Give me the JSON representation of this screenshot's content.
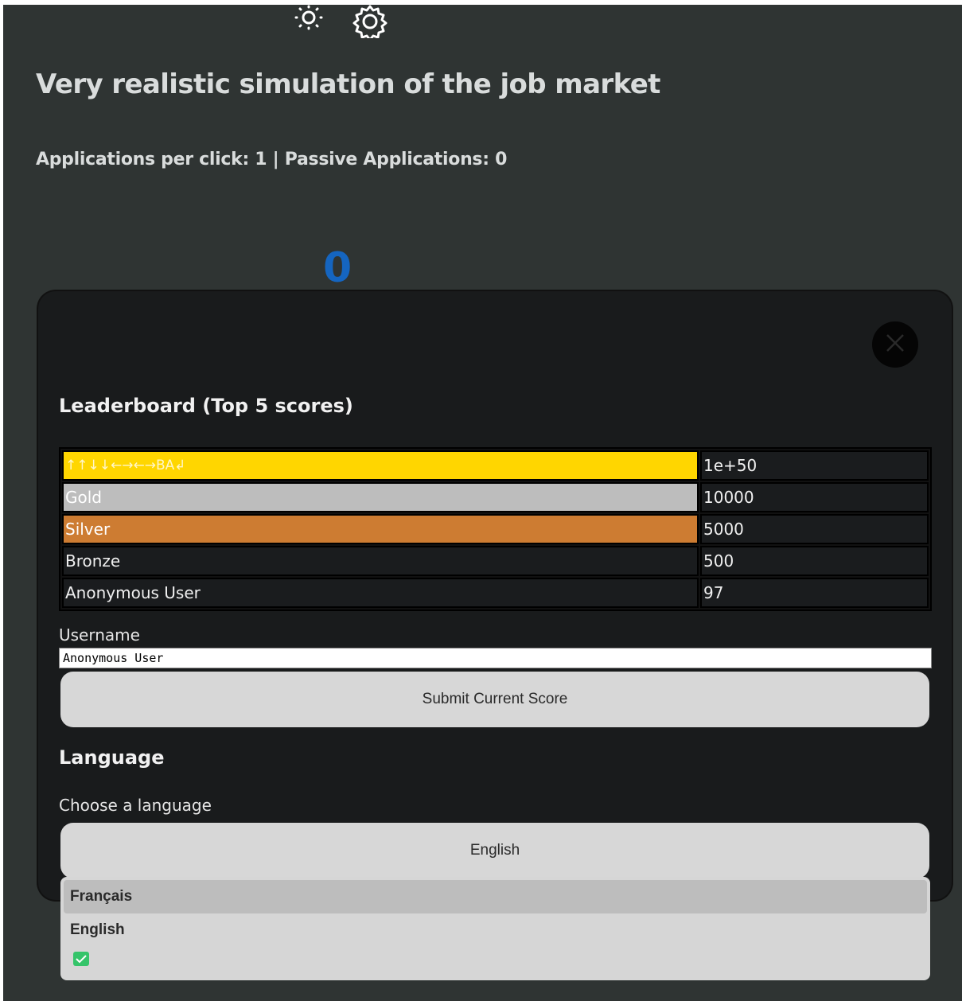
{
  "header": {
    "title": "Very realistic simulation of the job market",
    "stats": "Applications per click: 1 | Passive Applications: 0",
    "counter": "0"
  },
  "modal": {
    "leaderboard_heading": "Leaderboard (Top 5 scores)",
    "leaderboard": [
      {
        "name": "↑↑↓↓←→←→BA↲",
        "score": "1e+50"
      },
      {
        "name": "Gold",
        "score": "10000"
      },
      {
        "name": "Silver",
        "score": "5000"
      },
      {
        "name": "Bronze",
        "score": "500"
      },
      {
        "name": "Anonymous User",
        "score": "97"
      }
    ],
    "username_label": "Username",
    "username_value": "Anonymous User",
    "submit_label": "Submit Current Score",
    "language_heading": "Language",
    "language_sub": "Choose a language",
    "language_selected": "English",
    "language_options": [
      "Français",
      "English"
    ]
  },
  "colors": {
    "background": "#2f3433",
    "modal": "#191b1c",
    "counter": "#1565c0",
    "rank1": "#ffd600",
    "rank2": "#bdbdbd",
    "rank3": "#cd7c32"
  },
  "icons": [
    "sun-icon",
    "gear-icon",
    "close-icon",
    "checkmark-icon"
  ]
}
